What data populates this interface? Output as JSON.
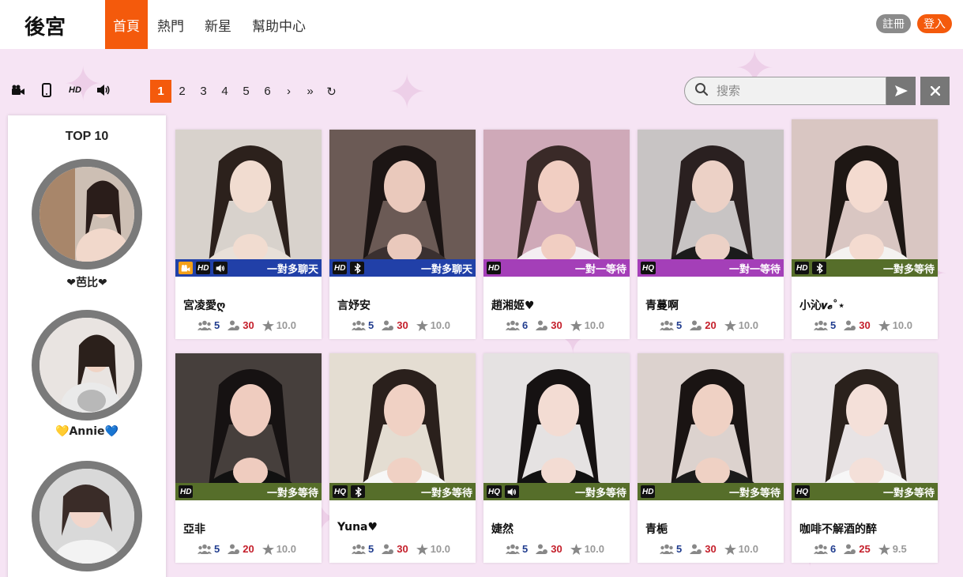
{
  "header": {
    "logo": "後宮",
    "nav": [
      "首頁",
      "熱門",
      "新星",
      "幫助中心"
    ],
    "register": "註冊",
    "login": "登入"
  },
  "filters": [
    "video-camera-icon",
    "mobile-icon",
    "HD",
    "speaker-icon"
  ],
  "pager": {
    "pages": [
      "1",
      "2",
      "3",
      "4",
      "5",
      "6"
    ],
    "next": "›",
    "last": "»",
    "refresh": "↻",
    "current": "1"
  },
  "search": {
    "placeholder": "搜索"
  },
  "sidebar": {
    "title": "TOP 10",
    "items": [
      {
        "name": "❤芭比❤"
      },
      {
        "name": "💛Annie💙"
      },
      {
        "name": ""
      }
    ]
  },
  "colors": {
    "accent": "#f45a0c",
    "strip_blue": "#2140a8",
    "strip_purple": "#a43fb8",
    "strip_green": "#566e2a"
  },
  "cards": [
    {
      "name": "宮凌愛ღ",
      "badges": [
        "video",
        "HD",
        "speaker"
      ],
      "status": "一對多聊天",
      "strip": "blue",
      "viewers": "5",
      "fans": "30",
      "score": "10.0"
    },
    {
      "name": "言妤安",
      "badges": [
        "HD",
        "bluetooth"
      ],
      "status": "一對多聊天",
      "strip": "blue",
      "viewers": "5",
      "fans": "30",
      "score": "10.0"
    },
    {
      "name": "趙湘姬♥",
      "badges": [
        "HD"
      ],
      "status": "一對一等待",
      "strip": "purple",
      "viewers": "6",
      "fans": "30",
      "score": "10.0"
    },
    {
      "name": "青蔓啊",
      "badges": [
        "HQ"
      ],
      "status": "一對一等待",
      "strip": "purple",
      "viewers": "5",
      "fans": "20",
      "score": "10.0"
    },
    {
      "name": "小沁𝒗𝓮˚⋆",
      "badges": [
        "HD",
        "bluetooth"
      ],
      "status": "一對多等待",
      "strip": "green",
      "viewers": "5",
      "fans": "30",
      "score": "10.0"
    },
    {
      "name": "亞非",
      "badges": [
        "HD"
      ],
      "status": "一對多等待",
      "strip": "green",
      "viewers": "5",
      "fans": "20",
      "score": "10.0"
    },
    {
      "name": "Yuna♥",
      "badges": [
        "HQ",
        "bluetooth"
      ],
      "status": "一對多等待",
      "strip": "green",
      "viewers": "5",
      "fans": "30",
      "score": "10.0"
    },
    {
      "name": "婕然",
      "badges": [
        "HQ",
        "speaker"
      ],
      "status": "一對多等待",
      "strip": "green",
      "viewers": "5",
      "fans": "30",
      "score": "10.0"
    },
    {
      "name": "青梔",
      "badges": [
        "HD"
      ],
      "status": "一對多等待",
      "strip": "green",
      "viewers": "5",
      "fans": "30",
      "score": "10.0"
    },
    {
      "name": "咖啡不解酒的醉",
      "badges": [
        "HQ"
      ],
      "status": "一對多等待",
      "strip": "green",
      "viewers": "6",
      "fans": "25",
      "score": "9.5"
    }
  ]
}
